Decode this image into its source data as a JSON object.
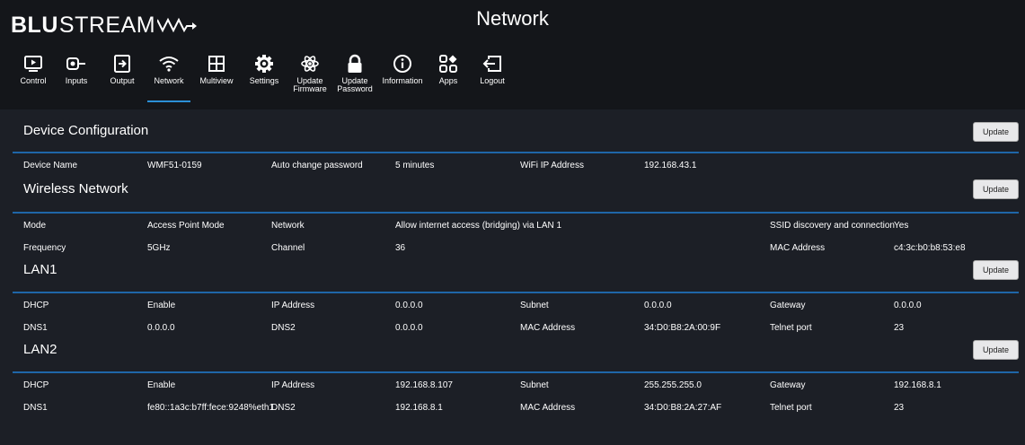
{
  "brand": {
    "logo_bold": "BLU",
    "logo_light": "STREAM"
  },
  "page_title": "Network",
  "nav": [
    {
      "label": "Control",
      "icon": "play-screen-icon",
      "active": false
    },
    {
      "label": "Inputs",
      "icon": "input-icon",
      "active": false
    },
    {
      "label": "Output",
      "icon": "output-icon",
      "active": false
    },
    {
      "label": "Network",
      "icon": "wifi-icon",
      "active": true
    },
    {
      "label": "Multiview",
      "icon": "multiview-icon",
      "active": false
    },
    {
      "label": "Settings",
      "icon": "gear-icon",
      "active": false
    },
    {
      "label": "Update\nFirmware",
      "icon": "atom-icon",
      "active": false
    },
    {
      "label": "Update\nPassword",
      "icon": "lock-icon",
      "active": false
    },
    {
      "label": "Information",
      "icon": "info-icon",
      "active": false
    },
    {
      "label": "Apps",
      "icon": "apps-icon",
      "active": false
    },
    {
      "label": "Logout",
      "icon": "logout-icon",
      "active": false
    }
  ],
  "update_label": "Update",
  "device_config": {
    "title": "Device Configuration",
    "row1": [
      "Device Name",
      "WMF51-0159",
      "Auto change password",
      "5 minutes",
      "WiFi IP Address",
      "192.168.43.1"
    ]
  },
  "wireless": {
    "title": "Wireless Network",
    "row1": [
      "Mode",
      "Access Point Mode",
      "Network",
      "Allow internet access (bridging) via LAN 1",
      "SSID discovery and connection",
      "Yes"
    ],
    "row2": [
      "Frequency",
      "5GHz",
      "Channel",
      "36",
      "MAC Address",
      "c4:3c:b0:b8:53:e8"
    ]
  },
  "lan1": {
    "title": "LAN1",
    "row1": [
      "DHCP",
      "Enable",
      "IP Address",
      "0.0.0.0",
      "Subnet",
      "0.0.0.0",
      "Gateway",
      "0.0.0.0"
    ],
    "row2": [
      "DNS1",
      "0.0.0.0",
      "DNS2",
      "0.0.0.0",
      "MAC Address",
      "34:D0:B8:2A:00:9F",
      "Telnet port",
      "23"
    ]
  },
  "lan2": {
    "title": "LAN2",
    "row1": [
      "DHCP",
      "Enable",
      "IP Address",
      "192.168.8.107",
      "Subnet",
      "255.255.255.0",
      "Gateway",
      "192.168.8.1"
    ],
    "row2": [
      "DNS1",
      "fe80::1a3c:b7ff:fece:9248%eth1",
      "DNS2",
      "192.168.8.1",
      "MAC Address",
      "34:D0:B8:2A:27:AF",
      "Telnet port",
      "23"
    ]
  }
}
